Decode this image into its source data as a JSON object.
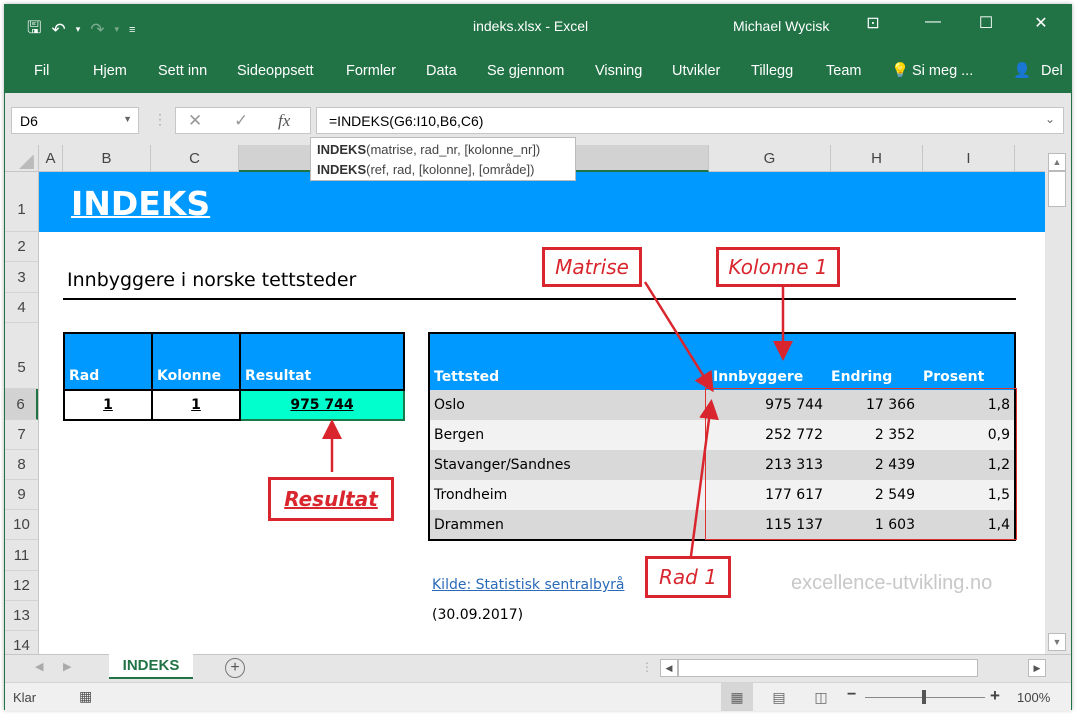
{
  "titlebar": {
    "qat": {
      "save_icon": "save-icon",
      "undo_icon": "undo-icon",
      "redo_icon": "redo-icon",
      "customize_icon": "customize-qat-icon"
    },
    "title": "indeks.xlsx  -  Excel",
    "user": "Michael Wycisk",
    "ribbon_display_icon": "ribbon-display-icon",
    "minimize_glyph": "—",
    "maximize_glyph": "☐",
    "close_glyph": "✕"
  },
  "ribbon": {
    "tabs": [
      "Fil",
      "Hjem",
      "Sett inn",
      "Sideoppsett",
      "Formler",
      "Data",
      "Se gjennom",
      "Visning",
      "Utvikler",
      "Tillegg",
      "Team"
    ],
    "tell_me": "Si meg ...",
    "share": "Del"
  },
  "formula_bar": {
    "name_box": "D6",
    "cancel_glyph": "✕",
    "enter_glyph": "✓",
    "fx_label": "fx",
    "formula": "=INDEKS(G6:I10,B6,C6)"
  },
  "tooltip": {
    "lines": [
      {
        "fn": "INDEKS",
        "args": "(matrise, rad_nr, [kolonne_nr])"
      },
      {
        "fn": "INDEKS",
        "args": "(ref, rad, [kolonne], [område])"
      }
    ]
  },
  "columns": [
    "A",
    "B",
    "C",
    "",
    "G",
    "H",
    "I"
  ],
  "rows": [
    "1",
    "2",
    "3",
    "4",
    "5",
    "6",
    "7",
    "8",
    "9",
    "10",
    "11",
    "12",
    "13",
    "14"
  ],
  "sheet": {
    "banner_title": "INDEKS",
    "subtitle": "Innbyggere i norske tettsteder",
    "lookup_table": {
      "headers": [
        "Rad",
        "Kolonne",
        "Resultat"
      ],
      "values": [
        "1",
        "1",
        "975 744"
      ]
    },
    "data_table": {
      "headers": [
        "Tettsted",
        "Innbyggere",
        "Endring",
        "Prosent"
      ],
      "rows": [
        [
          "Oslo",
          "975 744",
          "17 366",
          "1,8"
        ],
        [
          "Bergen",
          "252 772",
          "2 352",
          "0,9"
        ],
        [
          "Stavanger/Sandnes",
          "213 313",
          "2 439",
          "1,2"
        ],
        [
          "Trondheim",
          "177 617",
          "2 549",
          "1,5"
        ],
        [
          "Drammen",
          "115 137",
          "1 603",
          "1,4"
        ]
      ]
    },
    "source_link": "Kilde: Statistisk sentralbyrå",
    "date": "(30.09.2017)",
    "watermark": "excellence-utvikling.no"
  },
  "callouts": {
    "matrise": "Matrise",
    "kolonne": "Kolonne 1",
    "rad": "Rad 1",
    "resultat": "Resultat"
  },
  "sheet_tabs": {
    "active": "INDEKS",
    "add_glyph": "+"
  },
  "statusbar": {
    "status": "Klar",
    "zoom": "100%",
    "zoom_minus": "−",
    "zoom_plus": "+"
  },
  "colors": {
    "excel_green": "#217346",
    "banner_blue": "#0099ff",
    "result_fill": "#00ffcc",
    "callout_red": "#d9262e"
  }
}
